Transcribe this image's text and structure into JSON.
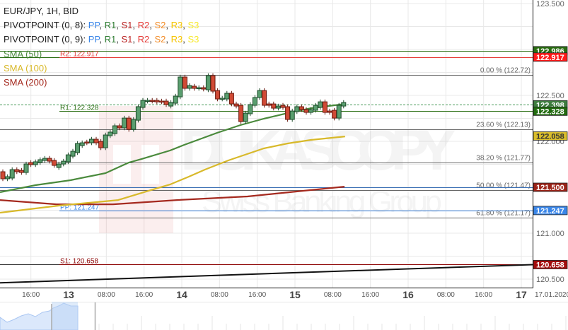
{
  "legend": {
    "symbol_line": "EUR/JPY, 1H, BID",
    "pivot_lines": [
      {
        "prefix": "PIVOTPOINT (0, 8): ",
        "items": [
          {
            "label": "PP",
            "color": "#3a86e8"
          },
          {
            "label": "R1",
            "color": "#2e7d32"
          },
          {
            "label": "S1",
            "color": "#b71c1c"
          },
          {
            "label": "R2",
            "color": "#e53935"
          },
          {
            "label": "S2",
            "color": "#f28c28"
          },
          {
            "label": "R3",
            "color": "#f5c400"
          },
          {
            "label": "S3",
            "color": "#f7e92a"
          }
        ]
      },
      {
        "prefix": "PIVOTPOINT (0, 9): ",
        "items": [
          {
            "label": "PP",
            "color": "#3a86e8"
          },
          {
            "label": "R1",
            "color": "#2e7d32"
          },
          {
            "label": "S1",
            "color": "#b71c1c"
          },
          {
            "label": "R2",
            "color": "#e53935"
          },
          {
            "label": "S2",
            "color": "#f28c28"
          },
          {
            "label": "R3",
            "color": "#f5c400"
          },
          {
            "label": "S3",
            "color": "#f7e92a"
          }
        ]
      }
    ],
    "sma": [
      {
        "label": "SMA (50)",
        "color": "#4a8a3c"
      },
      {
        "label": "SMA (100)",
        "color": "#d8b92a"
      },
      {
        "label": "SMA (200)",
        "color": "#a52a1f"
      }
    ]
  },
  "price_axis": {
    "ticks": [
      "123.500",
      "122.500",
      "122.000",
      "121.000",
      "120.500"
    ],
    "tick_values": [
      123.5,
      122.5,
      122.0,
      121.0,
      120.5
    ],
    "tags": [
      {
        "text": "122.986",
        "value": 122.986,
        "bg": "#2a6e12",
        "fg": "#ffffff"
      },
      {
        "text": "122.917",
        "value": 122.917,
        "bg": "#ff1a1a",
        "fg": "#ffffff"
      },
      {
        "text": "122.398",
        "value": 122.398,
        "bg": "#3f7d3f",
        "fg": "#ffffff"
      },
      {
        "text": "122.328",
        "value": 122.328,
        "bg": "#226b10",
        "fg": "#ffffff"
      },
      {
        "text": "122.058",
        "value": 122.058,
        "bg": "#d9bd2c",
        "fg": "#333333"
      },
      {
        "text": "121.500",
        "value": 121.5,
        "bg": "#9b2318",
        "fg": "#ffffff"
      },
      {
        "text": "121.247",
        "value": 121.247,
        "bg": "#3a86e8",
        "fg": "#ffffff"
      },
      {
        "text": "120.658",
        "value": 120.658,
        "bg": "#a30d0d",
        "fg": "#ffffff"
      }
    ]
  },
  "time_axis": {
    "ticks": [
      {
        "label": "16:00",
        "hour": -7,
        "day": false
      },
      {
        "label": "13",
        "hour": 1,
        "day": true
      },
      {
        "label": "08:00",
        "hour": 9,
        "day": false
      },
      {
        "label": "16:00",
        "hour": 17,
        "day": false
      },
      {
        "label": "14",
        "hour": 25,
        "day": true
      },
      {
        "label": "08:00",
        "hour": 33,
        "day": false
      },
      {
        "label": "16:00",
        "hour": 41,
        "day": false
      },
      {
        "label": "15",
        "hour": 49,
        "day": true
      },
      {
        "label": "08:00",
        "hour": 57,
        "day": false
      },
      {
        "label": "16:00",
        "hour": 65,
        "day": false
      },
      {
        "label": "16",
        "hour": 73,
        "day": true
      },
      {
        "label": "08:00",
        "hour": 81,
        "day": false
      },
      {
        "label": "16:00",
        "hour": 89,
        "day": false
      },
      {
        "label": "17",
        "hour": 97,
        "day": true
      }
    ],
    "date_label": "17.01.2020"
  },
  "levels": {
    "pivots": [
      {
        "name": "R2",
        "label": "R2: 122.917",
        "value": 122.917,
        "color": "#e53935"
      },
      {
        "name": "R1",
        "label": "R1: 122.328",
        "value": 122.328,
        "color": "#2a6e12"
      },
      {
        "name": "PP",
        "label": "PP: 121.247",
        "value": 121.247,
        "color": "#3a86e8"
      },
      {
        "name": "S1",
        "label": "S1: 120.658",
        "value": 120.658,
        "color": "#8b0000"
      }
    ],
    "other_lines": [
      {
        "value": 122.986,
        "color": "#2a6e12"
      },
      {
        "value": 121.5,
        "color": "#3a6fb5"
      }
    ],
    "fib": [
      {
        "label": "0.00 % (122.72)",
        "value": 122.72
      },
      {
        "label": "23.60 % (122.13)",
        "value": 122.13
      },
      {
        "label": "38.20 % (121.77)",
        "value": 121.77
      },
      {
        "label": "50.00 % (121.47)",
        "value": 121.47
      },
      {
        "label": "61.80 % (121.17)",
        "value": 121.17
      }
    ],
    "current_price": 122.398,
    "trendline": [
      120.46,
      120.658
    ]
  },
  "watermark": {
    "brand": "DUKASCOPY",
    "tagline": "Swiss Banking Group"
  },
  "chart_data": {
    "type": "candlestick",
    "symbol": "EUR/JPY",
    "timeframe": "1H",
    "up_color": "#5a9e6f",
    "down_color": "#d04a35",
    "candles_oc": [
      [
        121.669,
        121.592
      ],
      [
        121.592,
        121.615
      ],
      [
        121.6,
        121.692
      ],
      [
        121.692,
        121.669
      ],
      [
        121.684,
        121.661
      ],
      [
        121.661,
        121.753
      ],
      [
        121.769,
        121.746
      ],
      [
        121.746,
        121.777
      ],
      [
        121.769,
        121.8
      ],
      [
        121.792,
        121.815
      ],
      [
        121.815,
        121.784
      ],
      [
        121.792,
        121.738
      ],
      [
        121.715,
        121.753
      ],
      [
        121.753,
        121.784
      ],
      [
        121.777,
        121.853
      ],
      [
        121.838,
        121.892
      ],
      [
        121.877,
        121.977
      ],
      [
        121.954,
        121.984
      ],
      [
        121.992,
        121.984
      ],
      [
        121.984,
        122.023
      ],
      [
        122.023,
        121.984
      ],
      [
        121.999,
        121.93
      ],
      [
        121.93,
        122.069
      ],
      [
        122.061,
        122.1
      ],
      [
        122.084,
        122.169
      ],
      [
        122.169,
        122.146
      ],
      [
        122.146,
        122.253
      ],
      [
        122.253,
        122.13
      ],
      [
        122.13,
        122.238
      ],
      [
        122.23,
        122.377
      ],
      [
        122.369,
        122.446
      ],
      [
        122.438,
        122.446
      ],
      [
        122.446,
        122.438
      ],
      [
        122.446,
        122.43
      ],
      [
        122.438,
        122.43
      ],
      [
        122.438,
        122.4
      ],
      [
        122.384,
        122.423
      ],
      [
        122.415,
        122.492
      ],
      [
        122.484,
        122.7
      ],
      [
        122.7,
        122.577
      ],
      [
        122.577,
        122.607
      ],
      [
        122.6,
        122.577
      ],
      [
        122.577,
        122.584
      ],
      [
        122.584,
        122.569
      ],
      [
        122.561,
        122.715
      ],
      [
        122.715,
        122.546
      ],
      [
        122.553,
        122.461
      ],
      [
        122.461,
        122.469
      ],
      [
        122.461,
        122.523
      ],
      [
        122.523,
        122.407
      ],
      [
        122.407,
        122.384
      ],
      [
        122.392,
        122.215
      ],
      [
        122.215,
        122.307
      ],
      [
        122.3,
        122.4
      ],
      [
        122.392,
        122.477
      ],
      [
        122.477,
        122.553
      ],
      [
        122.553,
        122.392
      ],
      [
        122.407,
        122.392
      ],
      [
        122.407,
        122.361
      ],
      [
        122.361,
        122.384
      ],
      [
        122.392,
        122.369
      ],
      [
        122.377,
        122.238
      ],
      [
        122.238,
        122.33
      ],
      [
        122.323,
        122.377
      ],
      [
        122.377,
        122.346
      ],
      [
        122.346,
        122.315
      ],
      [
        122.315,
        122.346
      ],
      [
        122.338,
        122.392
      ],
      [
        122.369,
        122.43
      ],
      [
        122.43,
        122.315
      ],
      [
        122.33,
        122.315
      ],
      [
        122.338,
        122.253
      ],
      [
        122.253,
        122.392
      ],
      [
        122.384,
        122.423
      ]
    ],
    "sma50": [
      [
        -0.6,
        121.446
      ],
      [
        7,
        121.523
      ],
      [
        14.5,
        121.577
      ],
      [
        22,
        121.654
      ],
      [
        27,
        121.769
      ],
      [
        29.7,
        121.807
      ],
      [
        35.8,
        121.9
      ],
      [
        38.8,
        121.961
      ],
      [
        45.9,
        122.092
      ],
      [
        50.9,
        122.177
      ],
      [
        55.9,
        122.246
      ],
      [
        61,
        122.307
      ],
      [
        66,
        122.361
      ],
      [
        73.3,
        122.407
      ]
    ],
    "sma100": [
      [
        -0.6,
        121.223
      ],
      [
        12,
        121.3
      ],
      [
        24.7,
        121.361
      ],
      [
        32.7,
        121.484
      ],
      [
        35.8,
        121.53
      ],
      [
        39.8,
        121.615
      ],
      [
        43.3,
        121.692
      ],
      [
        48.3,
        121.792
      ],
      [
        55.9,
        121.923
      ],
      [
        61,
        121.977
      ],
      [
        66,
        122.015
      ],
      [
        73.3,
        122.053
      ]
    ],
    "sma200": [
      [
        -0.6,
        121.361
      ],
      [
        11.5,
        121.315
      ],
      [
        23.6,
        121.315
      ],
      [
        37.3,
        121.361
      ],
      [
        52.4,
        121.4
      ],
      [
        73.2,
        121.507
      ]
    ],
    "ylim": [
      120.42,
      123.54
    ]
  }
}
